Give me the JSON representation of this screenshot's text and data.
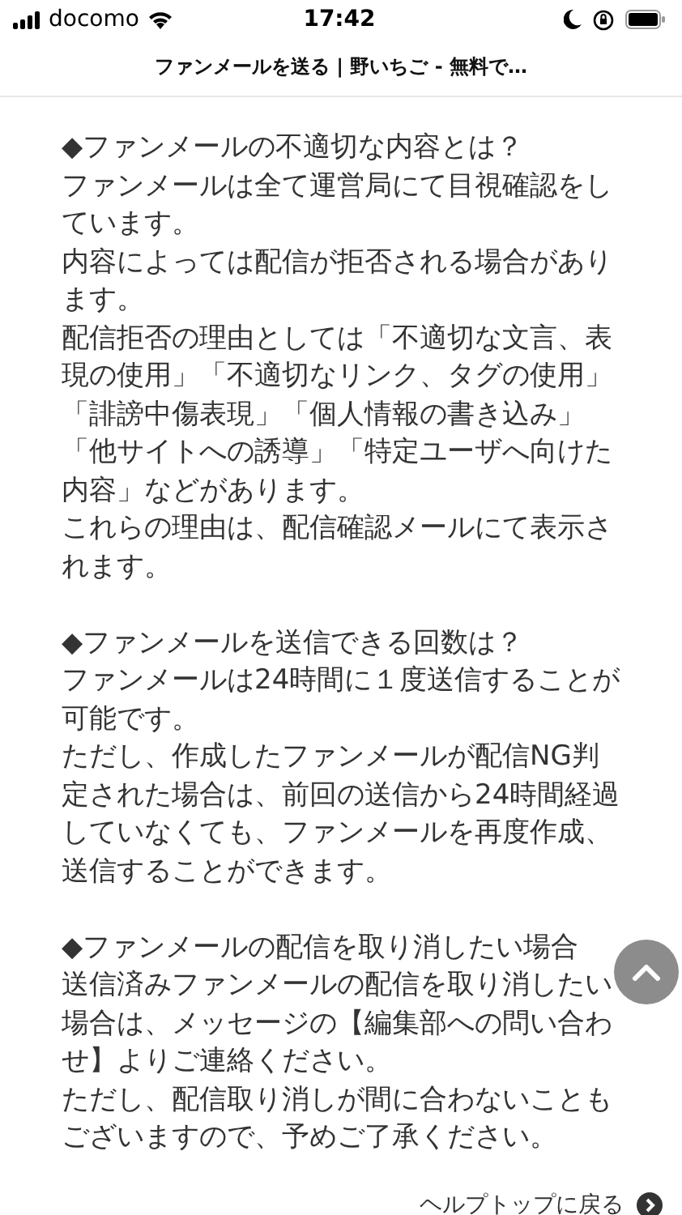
{
  "status_bar": {
    "carrier": "docomo",
    "time": "17:42"
  },
  "page_title": "ファンメールを送る | 野いちご - 無料で…",
  "sections": [
    {
      "heading": "◆ファンメールの不適切な内容とは？",
      "paragraphs": [
        "ファンメールは全て運営局にて目視確認をしています。",
        "内容によっては配信が拒否される場合があります。",
        "配信拒否の理由としては「不適切な文言、表現の使用」「不適切なリンク、タグの使用」「誹謗中傷表現」「個人情報の書き込み」「他サイトへの誘導」「特定ユーザへ向けた内容」などがあります。",
        "これらの理由は、配信確認メールにて表示されます。"
      ]
    },
    {
      "heading": "◆ファンメールを送信できる回数は？",
      "paragraphs": [
        "ファンメールは24時間に１度送信することが可能です。",
        "ただし、作成したファンメールが配信NG判定された場合は、前回の送信から24時間経過していなくても、ファンメールを再度作成、送信することができます。"
      ]
    },
    {
      "heading": "◆ファンメールの配信を取り消したい場合",
      "paragraphs": [
        "送信済みファンメールの配信を取り消したい場合は、メッセージの【編集部への問い合わせ】よりご連絡ください。",
        "ただし、配信取り消しが間に合わないこともございますので、予めご了承ください。"
      ]
    }
  ],
  "footer_link": "ヘルプトップに戻る"
}
